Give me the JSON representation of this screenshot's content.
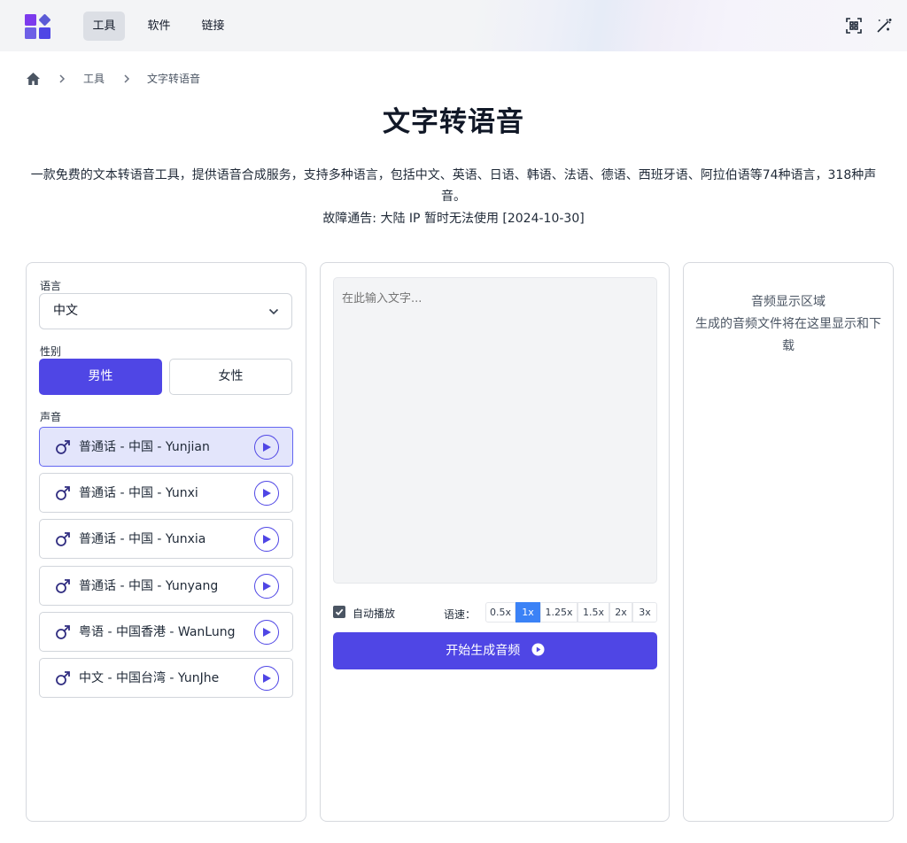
{
  "header": {
    "nav": [
      "工具",
      "软件",
      "链接"
    ],
    "icons": [
      "scan-icon",
      "magic-wand-icon"
    ]
  },
  "breadcrumb": {
    "home_icon": "home-icon",
    "items": [
      "工具",
      "文字转语音"
    ]
  },
  "page": {
    "title": "文字转语音",
    "description": "一款免费的文本转语音工具，提供语音合成服务，支持多种语言，包括中文、英语、日语、韩语、法语、德语、西班牙语、阿拉伯语等74种语言，318种声音。",
    "notice": "故障通告: 大陆 IP 暂时无法使用 [2024-10-30]"
  },
  "settings": {
    "language_label": "语言",
    "language_value": "中文",
    "gender_label": "性别",
    "gender_male": "男性",
    "gender_female": "女性",
    "voice_label": "声音",
    "voices": [
      "普通话 - 中国 - Yunjian",
      "普通话 - 中国 - Yunxi",
      "普通话 - 中国 - Yunxia",
      "普通话 - 中国 - Yunyang",
      "粤语 - 中国香港 - WanLung",
      "中文 - 中国台湾 - YunJhe"
    ],
    "selected_voice_index": 0
  },
  "editor": {
    "placeholder": "在此输入文字...",
    "autoplay_label": "自动播放",
    "autoplay_checked": true,
    "speed_label": "语速：",
    "speeds": [
      "0.5x",
      "1x",
      "1.25x",
      "1.5x",
      "2x",
      "3x"
    ],
    "selected_speed": "1x",
    "generate_label": "开始生成音频"
  },
  "audio": {
    "title": "音频显示区域",
    "hint": "生成的音频文件将在这里显示和下载"
  },
  "colors": {
    "accent": "#4f46e5",
    "speed_active": "#3b82f6",
    "selected_voice_bg": "#e3e5fb"
  }
}
